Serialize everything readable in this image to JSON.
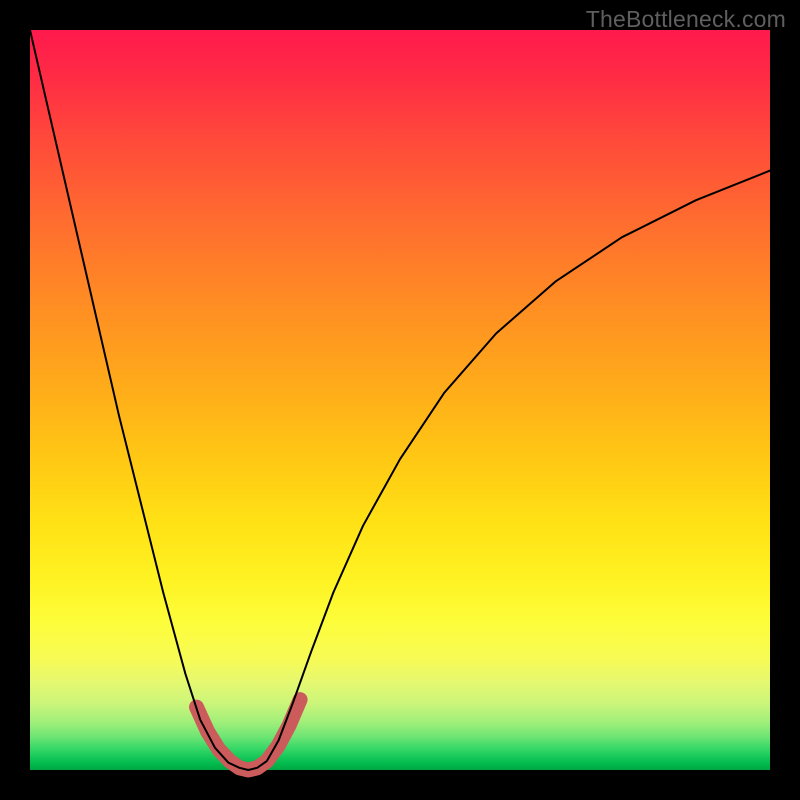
{
  "watermark": "TheBottleneck.com",
  "chart_data": {
    "type": "line",
    "title": "",
    "xlabel": "",
    "ylabel": "",
    "xlim": [
      0,
      1
    ],
    "ylim": [
      0,
      1
    ],
    "series": [
      {
        "name": "bottleneck-curve",
        "x": [
          0.0,
          0.03,
          0.06,
          0.09,
          0.12,
          0.15,
          0.18,
          0.21,
          0.23,
          0.25,
          0.268,
          0.283,
          0.295,
          0.307,
          0.32,
          0.336,
          0.355,
          0.38,
          0.41,
          0.45,
          0.5,
          0.56,
          0.63,
          0.71,
          0.8,
          0.9,
          1.0
        ],
        "y": [
          1.0,
          0.87,
          0.74,
          0.61,
          0.48,
          0.36,
          0.24,
          0.13,
          0.068,
          0.03,
          0.01,
          0.003,
          0.0,
          0.003,
          0.012,
          0.04,
          0.09,
          0.16,
          0.24,
          0.33,
          0.42,
          0.51,
          0.59,
          0.66,
          0.72,
          0.77,
          0.81
        ],
        "stroke": "#000000",
        "stroke_width": 2
      },
      {
        "name": "sweet-spot-highlight",
        "x": [
          0.225,
          0.24,
          0.255,
          0.27,
          0.283,
          0.295,
          0.307,
          0.32,
          0.335,
          0.35,
          0.365
        ],
        "y": [
          0.085,
          0.052,
          0.028,
          0.012,
          0.003,
          0.0,
          0.003,
          0.012,
          0.032,
          0.06,
          0.095
        ],
        "stroke": "#cc5b5b",
        "stroke_width": 15
      }
    ],
    "background_gradient": {
      "orientation": "vertical",
      "stops": [
        {
          "pos": 0.0,
          "color": "#ff1a4d"
        },
        {
          "pos": 0.5,
          "color": "#ffc814"
        },
        {
          "pos": 0.8,
          "color": "#fdfd3a"
        },
        {
          "pos": 1.0,
          "color": "#00a542"
        }
      ]
    }
  }
}
